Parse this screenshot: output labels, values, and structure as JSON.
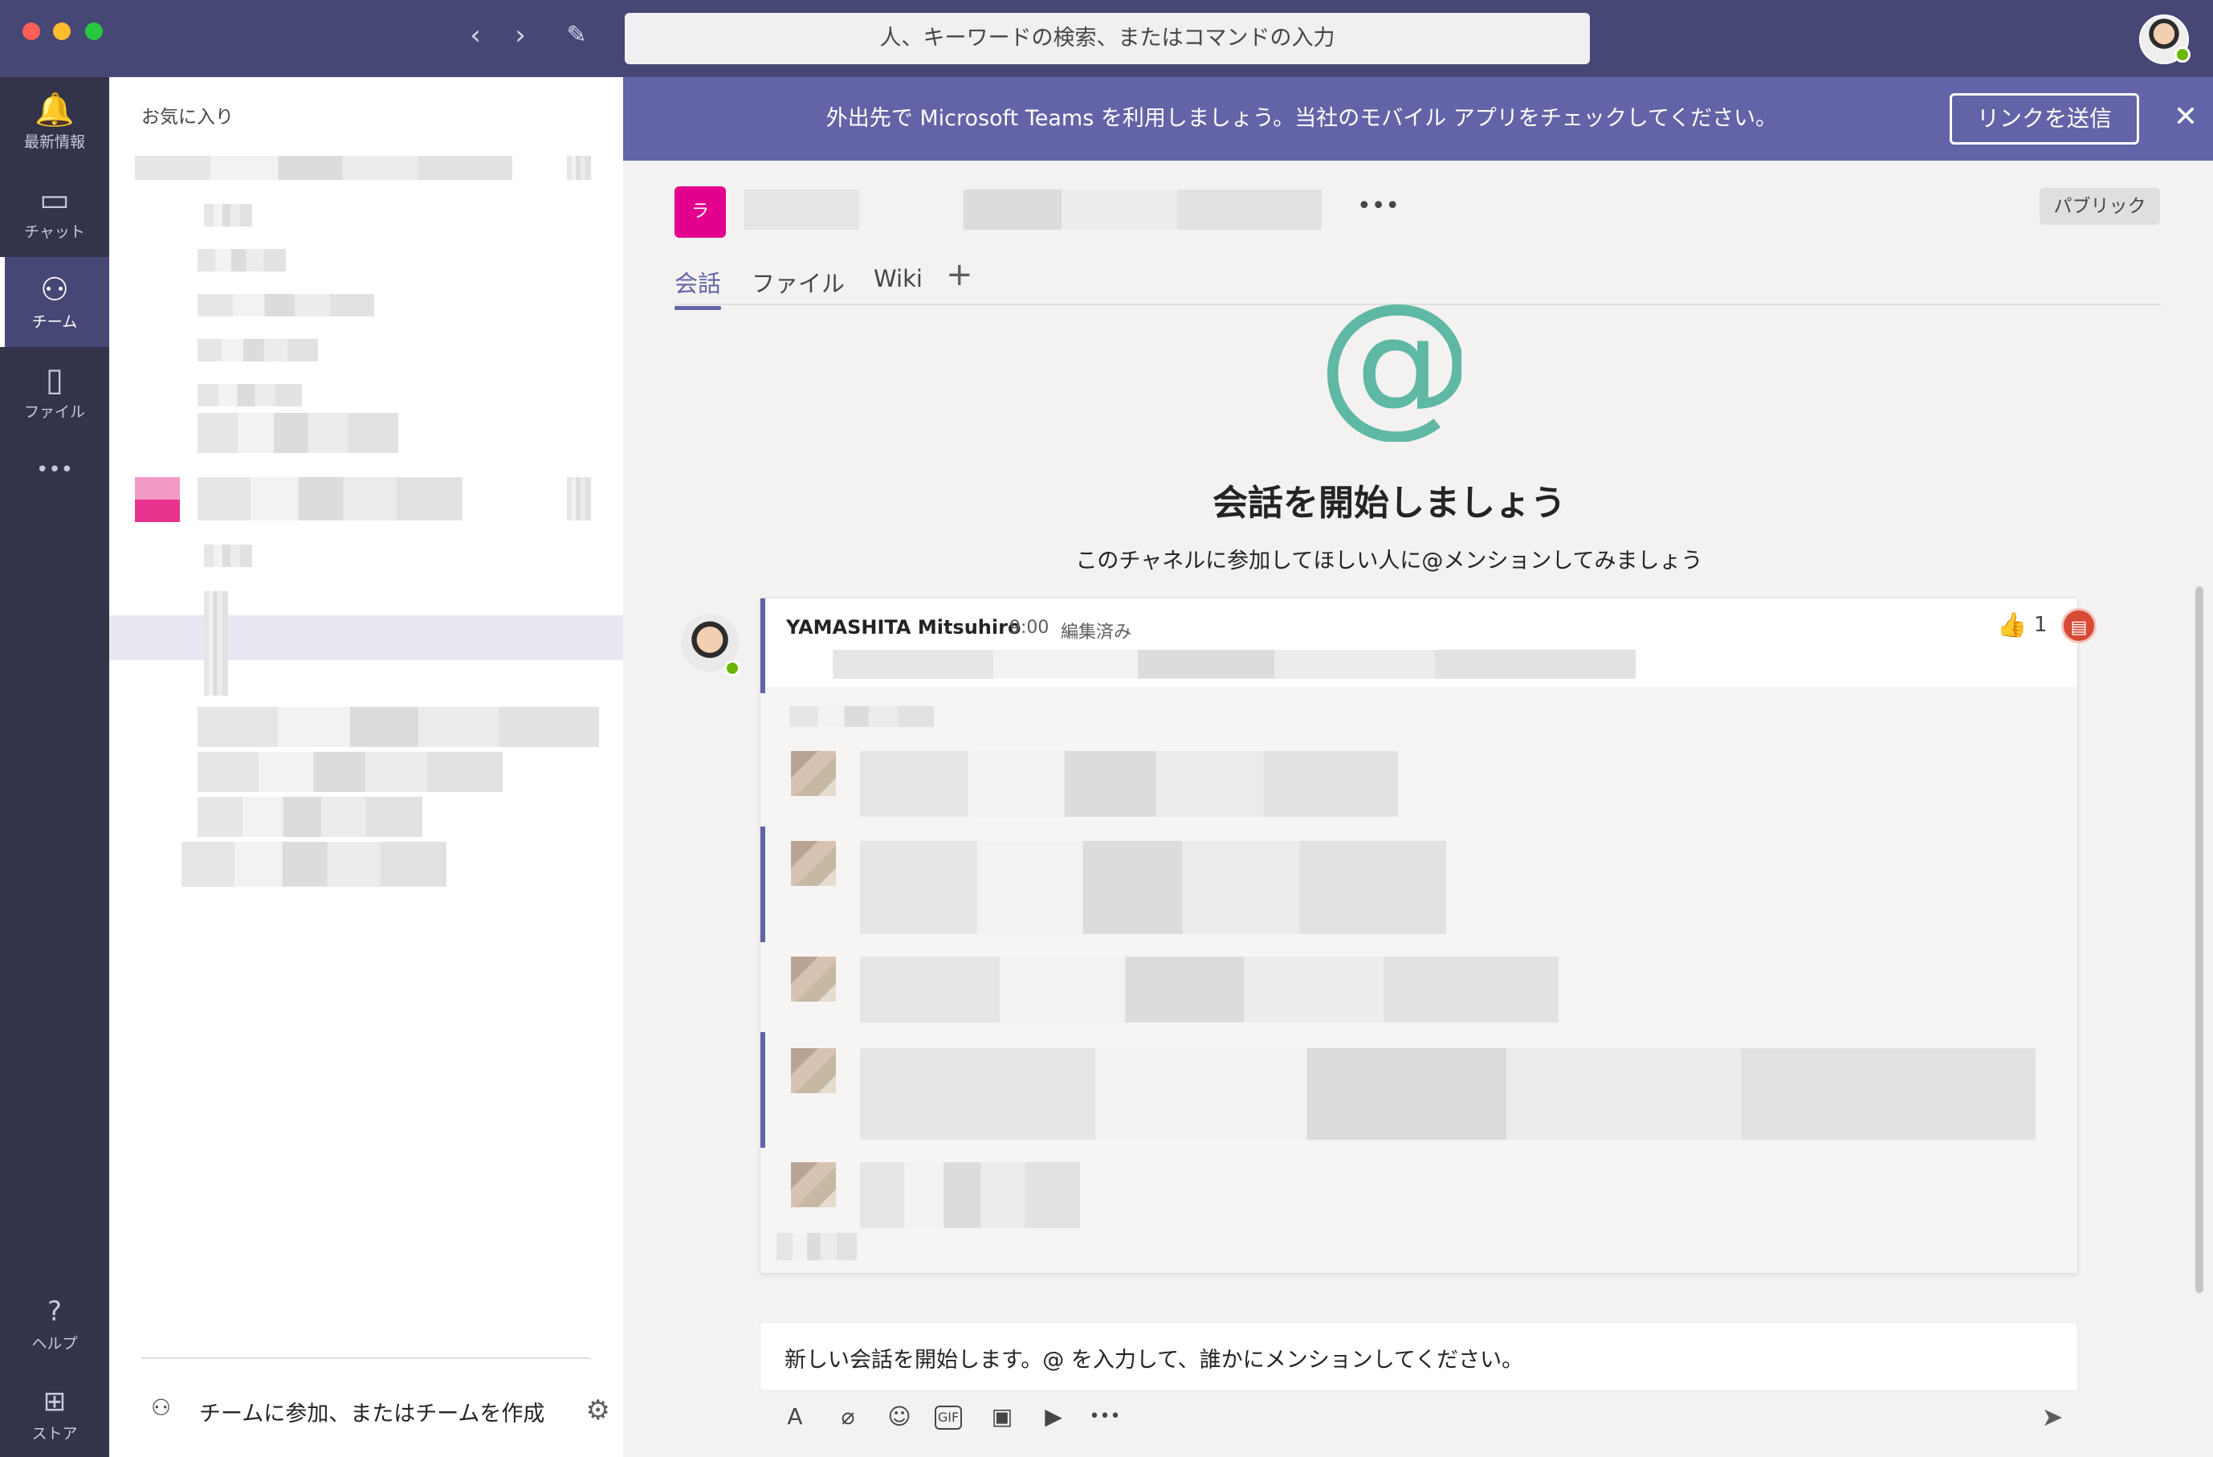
{
  "titlebar": {
    "search_placeholder": "人、キーワードの検索、またはコマンドの入力",
    "back_glyph": "‹",
    "forward_glyph": "›",
    "compose_glyph": "✎"
  },
  "rail": {
    "items": [
      {
        "label": "最新情報",
        "icon": "bell-icon",
        "glyph": "🔔"
      },
      {
        "label": "チャット",
        "icon": "chat-icon",
        "glyph": "▭"
      },
      {
        "label": "チーム",
        "icon": "teams-icon",
        "glyph": "⚇"
      },
      {
        "label": "ファイル",
        "icon": "file-icon",
        "glyph": "▯"
      }
    ],
    "more_glyph": "•••",
    "bottom": [
      {
        "label": "ヘルプ",
        "icon": "help-icon",
        "glyph": "?"
      },
      {
        "label": "ストア",
        "icon": "store-icon",
        "glyph": "⊞"
      }
    ]
  },
  "team_list": {
    "favorites_header": "お気に入り",
    "join_label": "チームに参加、またはチームを作成"
  },
  "banner": {
    "text": "外出先で Microsoft Teams を利用しましょう。当社のモバイル アプリをチェックしてください。",
    "button": "リンクを送信",
    "close_glyph": "✕"
  },
  "channel": {
    "avatar_letter": "ラ",
    "more_glyph": "•••",
    "badge": "パブリック",
    "tabs": [
      "会話",
      "ファイル",
      "Wiki"
    ],
    "active_tab": "会話",
    "add_tab_glyph": "+",
    "accent": "#6264a7"
  },
  "empty_state": {
    "glyph": "@",
    "title": "会話を開始しましょう",
    "subtitle": "このチャネルに参加してほしい人に@メンションしてみましょう"
  },
  "message": {
    "author": "YAMASHITA Mitsuhiro",
    "time": "9:00",
    "edited": "編集済み",
    "like_glyph": "👍",
    "likes": "1",
    "flag_glyph": "▤"
  },
  "compose": {
    "placeholder": "新しい会話を開始します。@ を入力して、誰かにメンションしてください。",
    "tools": [
      {
        "icon": "format-icon",
        "glyph": "A"
      },
      {
        "icon": "attach-icon",
        "glyph": "⌀"
      },
      {
        "icon": "emoji-icon",
        "glyph": "☺"
      },
      {
        "icon": "gif-icon",
        "glyph": "GIF"
      },
      {
        "icon": "sticker-icon",
        "glyph": "▣"
      },
      {
        "icon": "meet-icon",
        "glyph": "▶"
      },
      {
        "icon": "more-icon",
        "glyph": "•••"
      }
    ],
    "send_glyph": "➤"
  }
}
